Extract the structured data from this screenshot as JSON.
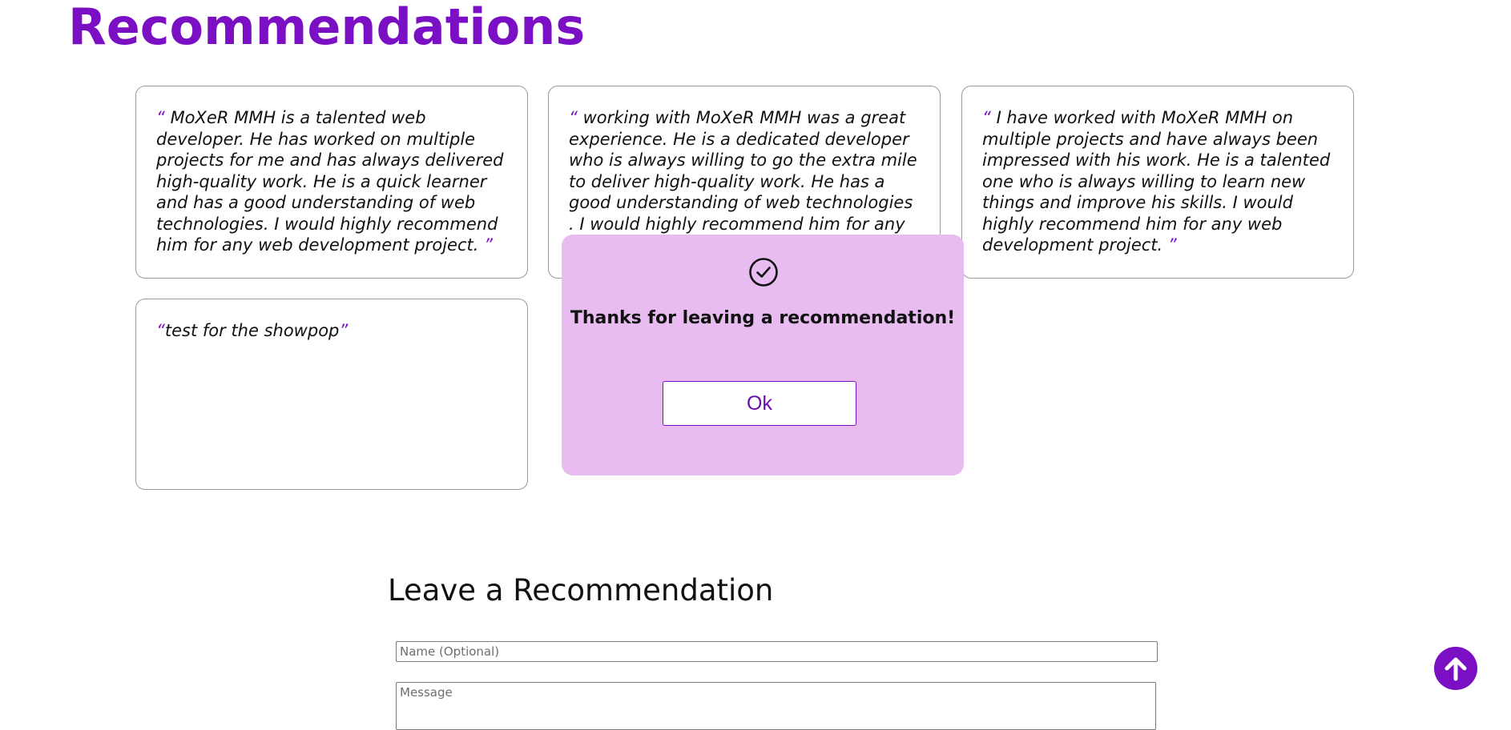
{
  "section": {
    "title": "Recommendations"
  },
  "quotes": {
    "open": "“",
    "close": "”"
  },
  "recommendations": [
    {
      "text": " MoXeR MMH is a talented web developer. He has worked on multiple projects for me and has always delivered high-quality work. He is a quick learner and has a good understanding of web technologies. I would highly recommend him for any web development project. "
    },
    {
      "text": " working with MoXeR MMH was a great experience. He is a dedicated developer who is always willing to go the extra mile to deliver high-quality work. He has a good understanding of web technologies . I would highly recommend him for any web development project. "
    },
    {
      "text": " I have worked with MoXeR MMH on multiple projects and have always been impressed with his work. He is a talented one who is always willing to learn new things and improve his skills. I would highly recommend him for any web development project. "
    },
    {
      "text": "test for the showpop"
    }
  ],
  "form": {
    "heading": "Leave a Recommendation",
    "name_placeholder": "Name (Optional)",
    "message_placeholder": "Message"
  },
  "popup": {
    "icon": "check-circle-icon",
    "message": "Thanks for leaving a recommendation!",
    "ok_label": "Ok"
  },
  "scroll_top": {
    "icon": "arrow-up-icon"
  },
  "colors": {
    "accent": "#7b0fc4",
    "popup_bg": "#e8bcf0",
    "card_border": "#9a9a9a"
  }
}
